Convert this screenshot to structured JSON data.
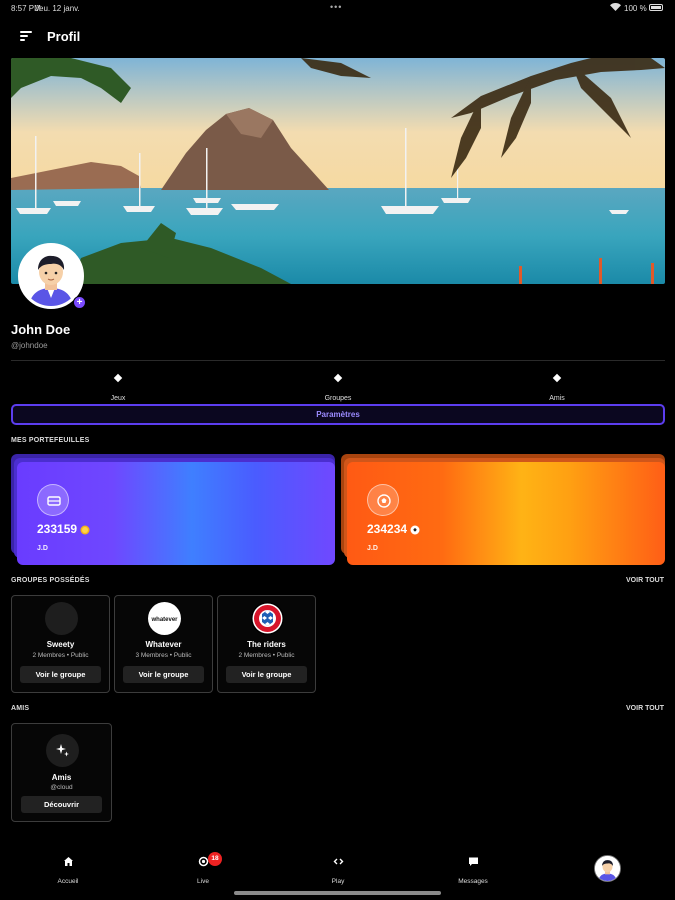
{
  "status_bar": {
    "time": "8:57 PM",
    "date": "Jeu. 12 janv.",
    "battery": "100 %"
  },
  "header": {
    "title": "Profil"
  },
  "profile": {
    "name": "John Doe",
    "handle": "@johndoe"
  },
  "stats": [
    {
      "label": "Jeux"
    },
    {
      "label": "Groupes"
    },
    {
      "label": "Amis"
    }
  ],
  "settings_button": "Paramètres",
  "sections": {
    "wallets": "MES PORTEFEUILLES",
    "groups": "GROUPES POSSÉDÉS",
    "friends": "AMIS",
    "see_all": "VOIR TOUT"
  },
  "wallets": [
    {
      "amount": "233159",
      "owner": "J.D",
      "icon": "ticket-icon",
      "coin": "gold-coin-icon",
      "color": "#6a3cff"
    },
    {
      "amount": "234234",
      "owner": "J.D",
      "icon": "soccer-ball-icon",
      "coin": "soccer-ball-icon",
      "color": "#ff6b12"
    }
  ],
  "groups": [
    {
      "name": "Sweety",
      "members": "2 Membres",
      "visibility": "Public",
      "button": "Voir le groupe"
    },
    {
      "name": "Whatever",
      "members": "3 Membres",
      "visibility": "Public",
      "button": "Voir le groupe",
      "logo_text": "whatever"
    },
    {
      "name": "The riders",
      "members": "2 Membres",
      "visibility": "Public",
      "button": "Voir le groupe"
    }
  ],
  "friends_card": {
    "name": "Amis",
    "handle": "@cloud",
    "button": "Découvrir"
  },
  "nav": {
    "items": [
      {
        "label": "Accueil",
        "icon": "home-icon"
      },
      {
        "label": "Live",
        "icon": "live-icon",
        "badge": "18"
      },
      {
        "label": "Play",
        "icon": "code-icon"
      },
      {
        "label": "Messages",
        "icon": "message-icon"
      }
    ]
  },
  "colors": {
    "accent": "#5c3df0",
    "background": "#000000"
  }
}
